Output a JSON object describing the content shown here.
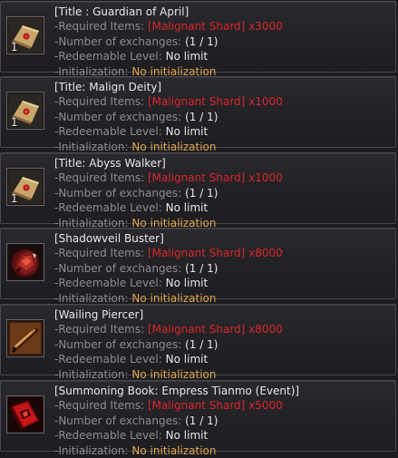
{
  "labels": {
    "required": "-Required Items:",
    "exchanges": "-Number of exchanges:",
    "level": "-Redeemable Level:",
    "init": "-Initialization:"
  },
  "items": [
    {
      "name": "[Title : Guardian of April]",
      "required": "[Malignant Shard] x3000",
      "exchanges": "(1 / 1)",
      "level": "No limit",
      "init": "No initialization",
      "quantity": "1",
      "icon": "scroll-icon"
    },
    {
      "name": "[Title: Malign Deity]",
      "required": "[Malignant Shard] x1000",
      "exchanges": "(1 / 1)",
      "level": "No limit",
      "init": "No initialization",
      "quantity": "1",
      "icon": "scroll-icon"
    },
    {
      "name": "[Title: Abyss Walker]",
      "required": "[Malignant Shard] x1000",
      "exchanges": "(1 / 1)",
      "level": "No limit",
      "init": "No initialization",
      "quantity": "1",
      "icon": "scroll-icon"
    },
    {
      "name": "[Shadowveil Buster]",
      "required": "[Malignant Shard] x8000",
      "exchanges": "(1 / 1)",
      "level": "No limit",
      "init": "No initialization",
      "quantity": "",
      "icon": "buster-gauntlet-icon"
    },
    {
      "name": "[Wailing Piercer]",
      "required": "[Malignant Shard] x8000",
      "exchanges": "(1 / 1)",
      "level": "No limit",
      "init": "No initialization",
      "quantity": "",
      "icon": "piercer-blade-icon"
    },
    {
      "name": "[Summoning Book: Empress Tianmo (Event)]",
      "required": "[Malignant Shard] x5000",
      "exchanges": "(1 / 1)",
      "level": "No limit",
      "init": "No initialization",
      "quantity": "",
      "icon": "summoning-book-icon"
    }
  ]
}
